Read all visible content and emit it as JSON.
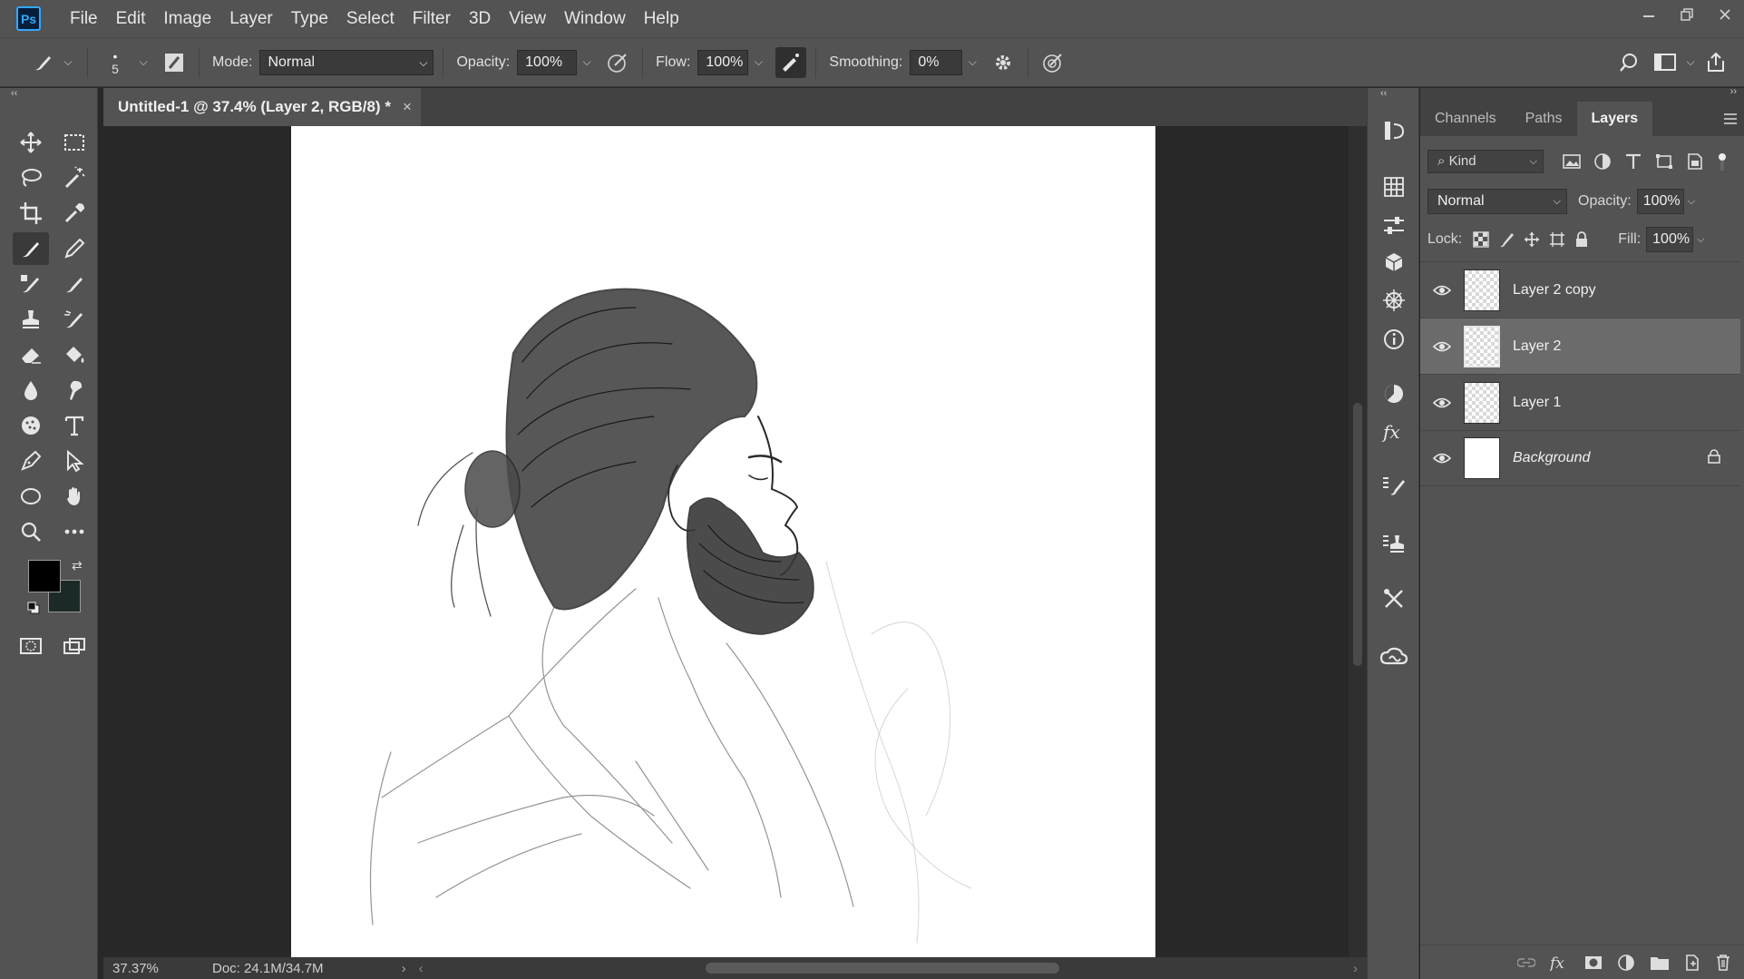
{
  "app": {
    "logo": "Ps"
  },
  "menu": [
    "File",
    "Edit",
    "Image",
    "Layer",
    "Type",
    "Select",
    "Filter",
    "3D",
    "View",
    "Window",
    "Help"
  ],
  "options": {
    "brush_size": "5",
    "mode_label": "Mode:",
    "mode_value": "Normal",
    "opacity_label": "Opacity:",
    "opacity_value": "100%",
    "flow_label": "Flow:",
    "flow_value": "100%",
    "smoothing_label": "Smoothing:",
    "smoothing_value": "0%"
  },
  "document": {
    "tab_title": "Untitled-1 @ 37.4% (Layer 2, RGB/8) *",
    "close_glyph": "×"
  },
  "status": {
    "zoom": "37.37%",
    "doc_size": "Doc: 24.1M/34.7M"
  },
  "panel": {
    "tabs": [
      "Channels",
      "Paths",
      "Layers"
    ],
    "active_tab": "Layers",
    "kind_label": "Kind",
    "blend_mode": "Normal",
    "opacity_label": "Opacity:",
    "opacity_value": "100%",
    "lock_label": "Lock:",
    "fill_label": "Fill:",
    "fill_value": "100%",
    "layers": [
      {
        "name": "Layer 2 copy",
        "selected": false,
        "thumb": "transparent"
      },
      {
        "name": "Layer 2",
        "selected": true,
        "thumb": "transparent"
      },
      {
        "name": "Layer 1",
        "selected": false,
        "thumb": "transparent"
      },
      {
        "name": "Background",
        "selected": false,
        "thumb": "white",
        "locked": true
      }
    ]
  },
  "colors": {
    "foreground": "#000000",
    "background": "#1b2a26",
    "accent": "#31a8ff"
  }
}
